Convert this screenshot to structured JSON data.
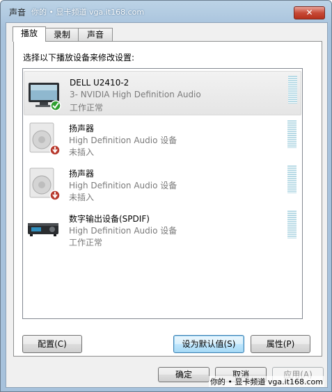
{
  "window": {
    "title": "声音",
    "watermark": "你的 • 显卡频道  vga.it168.com",
    "close_label": "✕"
  },
  "tabs": [
    {
      "label": "播放"
    },
    {
      "label": "录制"
    },
    {
      "label": "声音"
    }
  ],
  "instruction": "选择以下播放设备来修改设置:",
  "devices": [
    {
      "name": "DELL U2410-2",
      "desc": "3- NVIDIA High Definition Audio",
      "status": "工作正常",
      "icon": "monitor-icon",
      "badge": "check-badge"
    },
    {
      "name": "扬声器",
      "desc": "High Definition Audio 设备",
      "status": "未插入",
      "icon": "speaker-icon",
      "badge": "unplugged-badge"
    },
    {
      "name": "扬声器",
      "desc": "High Definition Audio 设备",
      "status": "未插入",
      "icon": "speaker-icon",
      "badge": "unplugged-badge"
    },
    {
      "name": "数字输出设备(SPDIF)",
      "desc": "High Definition Audio 设备",
      "status": "工作正常",
      "icon": "receiver-icon",
      "badge": ""
    }
  ],
  "buttons": {
    "configure": "配置(C)",
    "set_default": "设为默认值(S)",
    "properties": "属性(P)",
    "ok": "确定",
    "cancel": "取消",
    "apply": "应用(A)"
  },
  "bottom_watermark": "你的 • 显卡频道   vga.it168.com",
  "colors": {
    "meter": "#b9dbe6",
    "check": "#2e9e2e",
    "unplugged": "#b83a2e"
  }
}
